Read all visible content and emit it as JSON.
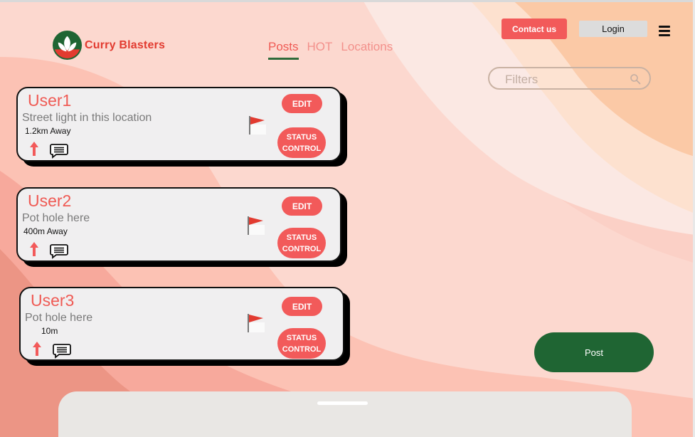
{
  "brand": {
    "name": "Curry Blasters"
  },
  "nav": {
    "posts": "Posts",
    "hot": "HOT",
    "locations": "Locations"
  },
  "header": {
    "contact_label": "Contact us",
    "login_label": "Login"
  },
  "filters": {
    "placeholder": "Filters"
  },
  "posts": [
    {
      "user": "User1",
      "description": "Street light in this location",
      "distance": "1.2km Away",
      "edit_label": "EDIT",
      "status_label": "STATUS\nCONTROL"
    },
    {
      "user": "User2",
      "description": "Pot hole here",
      "distance": "400m Away",
      "edit_label": "EDIT",
      "status_label": "STATUS\nCONTROL"
    },
    {
      "user": "User3",
      "description": "Pot hole here",
      "distance": "10m",
      "edit_label": "EDIT",
      "status_label": "STATUS\nCONTROL"
    }
  ],
  "actions": {
    "post_label": "Post"
  },
  "colors": {
    "accent": "#f25a5a",
    "brand_green": "#1f6533",
    "brand_red": "#e23b30",
    "card_bg": "#f0eff0"
  },
  "icons": [
    "logo-icon",
    "menu-icon",
    "search-icon",
    "upvote-arrow-icon",
    "comment-icon",
    "flag-icon"
  ]
}
